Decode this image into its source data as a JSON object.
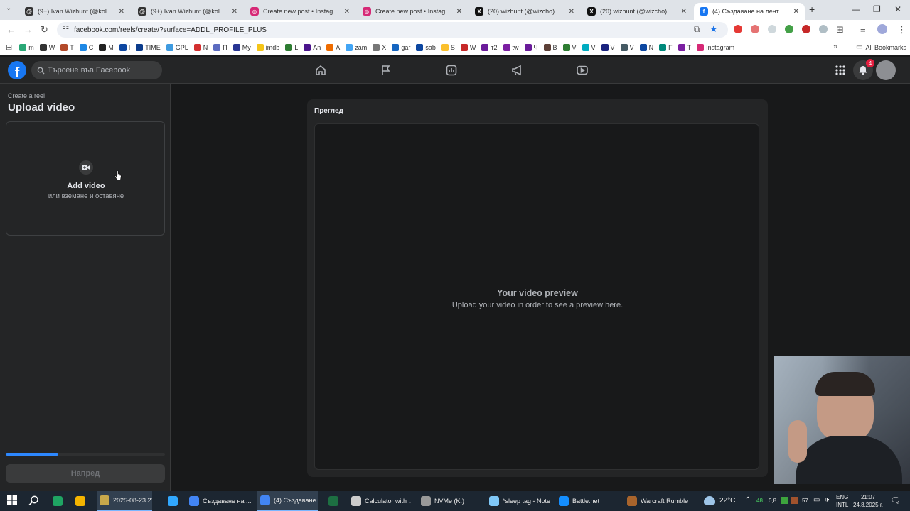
{
  "browser": {
    "tabs": [
      {
        "title": "(9+) Ivan Wizhunt (@kolewow)",
        "icon": "threads-icon"
      },
      {
        "title": "(9+) Ivan Wizhunt (@kolewow)",
        "icon": "threads-icon"
      },
      {
        "title": "Create new post • Instagram",
        "icon": "instagram-icon"
      },
      {
        "title": "Create new post • Instagram",
        "icon": "instagram-icon"
      },
      {
        "title": "(20) wizhunt (@wizcho) / X",
        "icon": "x-icon"
      },
      {
        "title": "(20) wizhunt (@wizcho) / X",
        "icon": "x-icon"
      },
      {
        "title": "(4) Създаване на лента | Facebook",
        "icon": "facebook-icon",
        "active": true
      }
    ],
    "new_tab": "+",
    "url": "facebook.com/reels/create/?surface=ADDL_PROFILE_PLUS",
    "bookmarks": [
      {
        "label": "m",
        "color": "#2aa876"
      },
      {
        "label": "W",
        "color": "#333333"
      },
      {
        "label": "T",
        "color": "#b34a2a"
      },
      {
        "label": "C",
        "color": "#1e88e5"
      },
      {
        "label": "M",
        "color": "#222222"
      },
      {
        "label": "I",
        "color": "#0d47a1"
      },
      {
        "label": "TIME",
        "color": "#0b3c8c"
      },
      {
        "label": "GPL",
        "color": "#3f9be0"
      },
      {
        "label": "N",
        "color": "#d32f2f"
      },
      {
        "label": "П",
        "color": "#5c6bc0"
      },
      {
        "label": "My",
        "color": "#283593"
      },
      {
        "label": "imdb",
        "color": "#f5c518"
      },
      {
        "label": "L",
        "color": "#2e7d32"
      },
      {
        "label": "An",
        "color": "#4a148c"
      },
      {
        "label": "A",
        "color": "#ef6c00"
      },
      {
        "label": "zam",
        "color": "#42a5f5"
      },
      {
        "label": "X",
        "color": "#777777"
      },
      {
        "label": "gar",
        "color": "#1565c0"
      },
      {
        "label": "sab",
        "color": "#0d47a1"
      },
      {
        "label": "S",
        "color": "#fbc02d"
      },
      {
        "label": "W",
        "color": "#c62828"
      },
      {
        "label": "т2",
        "color": "#6a1b9a"
      },
      {
        "label": "tw",
        "color": "#7b1fa2"
      },
      {
        "label": "Ч",
        "color": "#6a1b9a"
      },
      {
        "label": "B",
        "color": "#5d4037"
      },
      {
        "label": "V",
        "color": "#2e7d32"
      },
      {
        "label": "V",
        "color": "#00acc1"
      },
      {
        "label": "V",
        "color": "#1a237e"
      },
      {
        "label": "V",
        "color": "#455a64"
      },
      {
        "label": "N",
        "color": "#0d47a1"
      },
      {
        "label": "F",
        "color": "#00897b"
      },
      {
        "label": "T",
        "color": "#7b1fa2"
      },
      {
        "label": "Instagram",
        "color": "#d62976"
      }
    ],
    "all_bookmarks": "All Bookmarks"
  },
  "fb": {
    "search_placeholder": "Търсене във Facebook",
    "notification_count": "4"
  },
  "create": {
    "breadcrumb": "Create a reel",
    "title": "Upload video",
    "add_video": "Add video",
    "drag_drop": "или вземане и оставяне",
    "progress": 0.33,
    "next": "Напред"
  },
  "preview": {
    "label": "Преглед",
    "title": "Your video preview",
    "subtitle": "Upload your video in order to see a preview here."
  },
  "taskbar": {
    "items": [
      {
        "label": "",
        "color": "#1fa463"
      },
      {
        "label": "",
        "color": "#f4b400"
      },
      {
        "label": "2025-08-23 21-0...",
        "color": "#c8a84b",
        "active": true
      },
      {
        "label": "",
        "color": "#31a8ff"
      },
      {
        "label": "Създаване на ...",
        "color": "#4285f4"
      },
      {
        "label": "(4) Създаване н...",
        "color": "#4285f4",
        "active": true
      },
      {
        "label": "",
        "color": "#1d6f42"
      },
      {
        "label": "Calculator with ...",
        "color": "#cccccc"
      },
      {
        "label": "NVMe (K:)",
        "color": "#999999"
      },
      {
        "label": "*sleep tag - Note...",
        "color": "#7fc8f8"
      },
      {
        "label": "Battle.net",
        "color": "#148eff"
      },
      {
        "label": "Warcraft Rumble",
        "color": "#a8642c"
      }
    ],
    "weather": "22°C",
    "tray_nums": [
      "48",
      "0,8",
      "57"
    ],
    "lang": "ENG",
    "lang_sub": "INTL",
    "time": "21:07",
    "date": "24.8.2025 г."
  }
}
